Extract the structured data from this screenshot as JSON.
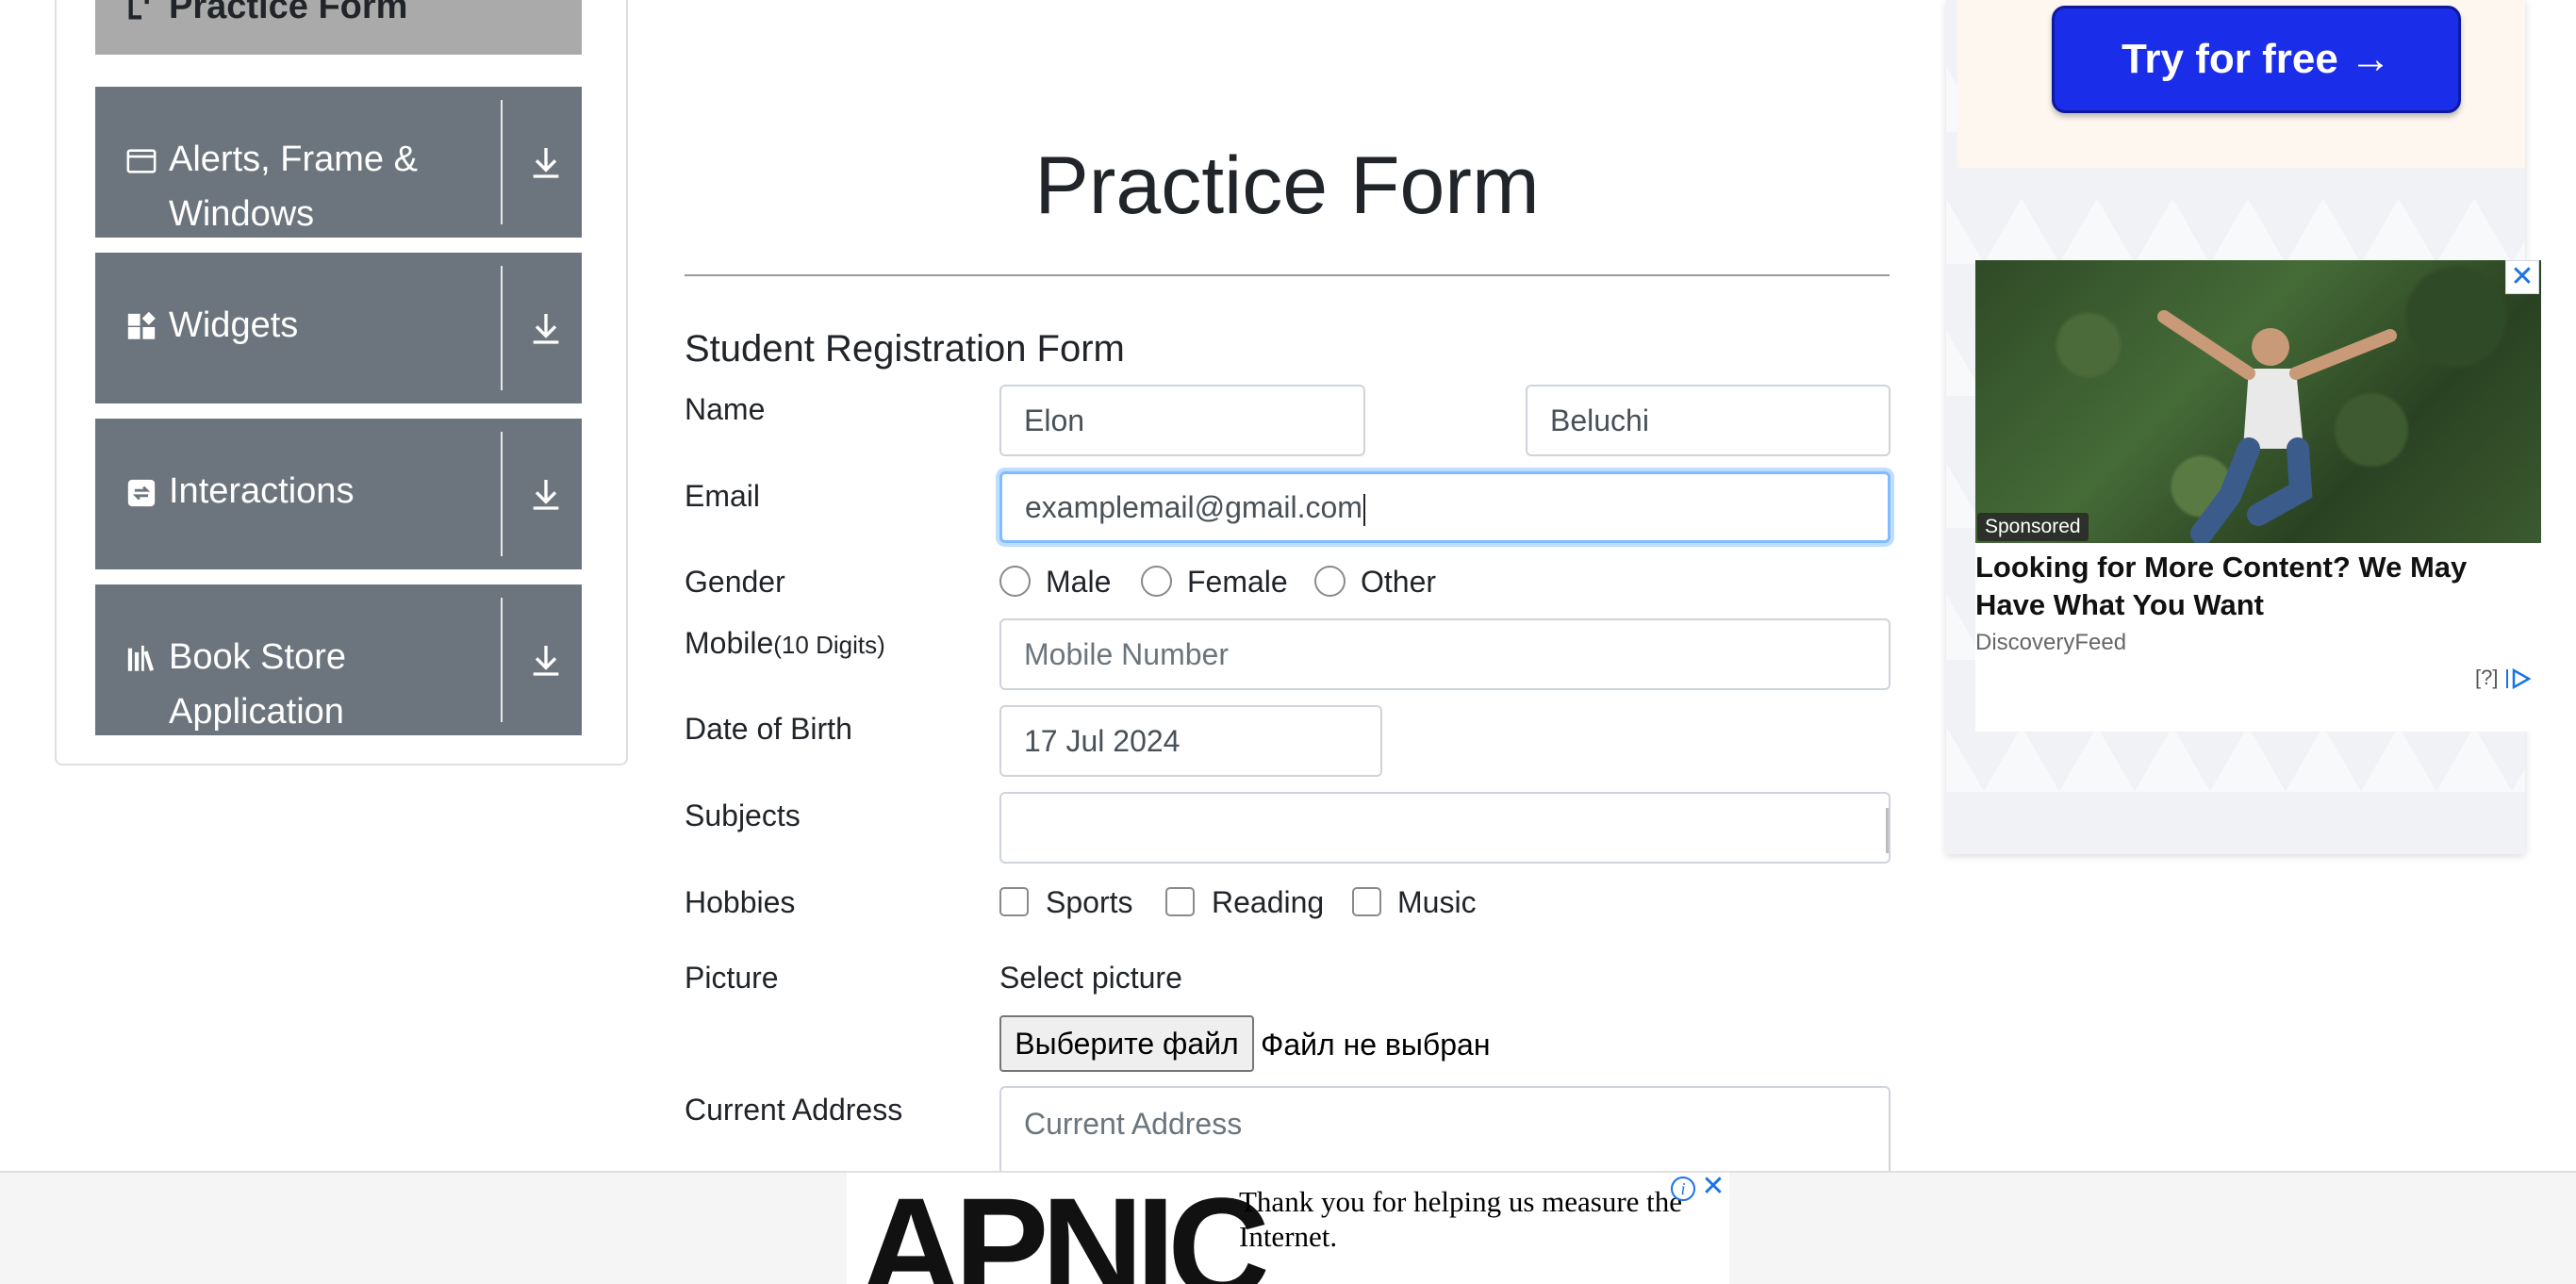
{
  "sidebar": {
    "active_group": "Practice Form",
    "groups": [
      {
        "label_line1": "Alerts, Frame &",
        "label_line2": "Windows",
        "icon": "window-icon"
      },
      {
        "label_line1": "Widgets",
        "icon": "widgets-icon"
      },
      {
        "label_line1": "Interactions",
        "icon": "interactions-icon"
      },
      {
        "label_line1": "Book Store",
        "label_line2": "Application",
        "icon": "books-icon"
      }
    ]
  },
  "main": {
    "title": "Practice Form",
    "form_heading": "Student Registration Form",
    "labels": {
      "name": "Name",
      "email": "Email",
      "gender": "Gender",
      "mobile": "Mobile",
      "mobile_hint": "(10 Digits)",
      "dob": "Date of Birth",
      "subjects": "Subjects",
      "hobbies": "Hobbies",
      "picture": "Picture",
      "current_address": "Current Address"
    },
    "fields": {
      "first_name": "Elon",
      "last_name": "Beluchi",
      "email": "examplemail@gmail.com",
      "mobile_placeholder": "Mobile Number",
      "dob": "17 Jul 2024",
      "subjects": "",
      "address_placeholder": "Current Address"
    },
    "gender_options": [
      "Male",
      "Female",
      "Other"
    ],
    "hobby_options": [
      "Sports",
      "Reading",
      "Music"
    ],
    "picture": {
      "select_label": "Select picture",
      "button_label": "Выберите файл",
      "status": "Файл не выбран"
    }
  },
  "ads": {
    "try_button": "Try for free →",
    "card": {
      "badge": "Sponsored",
      "headline": "Looking for More Content? We May Have What You Want",
      "source": "DiscoveryFeed",
      "info": "[?]",
      "close": "✕"
    },
    "banner": {
      "logo": "APNIC",
      "text": "Thank you for helping us measure the Internet.",
      "info": "i",
      "close": "✕"
    }
  },
  "colors": {
    "sidebar_group": "#6c757d",
    "sidebar_active": "#aaaaaa",
    "focus_border": "#80bdff",
    "cta_blue": "#1a2de8",
    "ad_link_blue": "#1a73e8"
  }
}
